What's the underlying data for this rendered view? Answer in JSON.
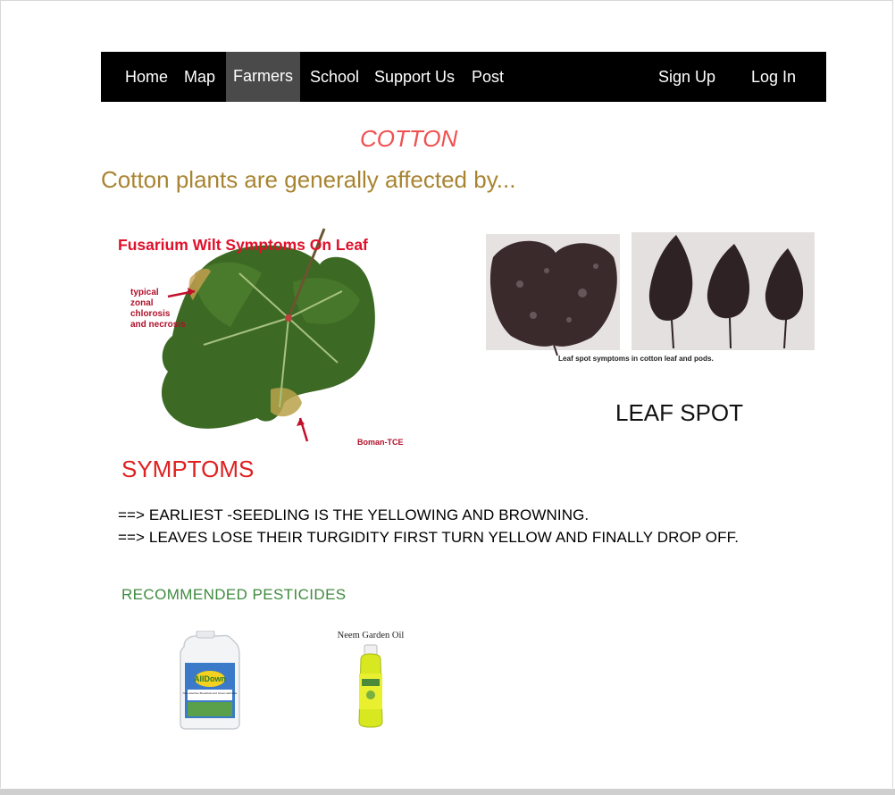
{
  "nav": {
    "items": [
      "Home",
      "Map",
      "Farmers",
      "School",
      "Support Us",
      "Post"
    ],
    "active": "Farmers",
    "signup": "Sign Up",
    "login": "Log In"
  },
  "page": {
    "title": "COTTON",
    "intro": "Cotton plants are generally affected by..."
  },
  "images": {
    "fusarium": {
      "heading": "Fusarium Wilt Symptoms On Leaf",
      "note_lines": [
        "typical",
        "zonal",
        "chlorosis",
        "and necrosis"
      ],
      "credit": "Boman-TCE"
    },
    "leafspot": {
      "inner_caption": "Leaf spot symptoms in cotton leaf and pods.",
      "label": "LEAF SPOT"
    }
  },
  "symptoms": {
    "heading": "SYMPTOMS",
    "lines": [
      "==> EARLIEST -SEEDLING IS THE YELLOWING AND BROWNING.",
      "==> LEAVES LOSE THEIR TURGIDITY FIRST TURN YELLOW AND FINALLY DROP OFF."
    ]
  },
  "pesticides": {
    "heading": "RECOMMENDED PESTICIDES",
    "products": [
      {
        "label": "AllDown",
        "sublabel": "Non-selective Broadcast and Grass Herbicide"
      },
      {
        "label": "Neem Garden Oil"
      }
    ]
  },
  "colors": {
    "nav_bg": "#000000",
    "nav_active": "#4a4a4a",
    "title": "#f05050",
    "intro": "#a88432",
    "symptoms": "#e02020",
    "recommended": "#3f8a3f"
  }
}
